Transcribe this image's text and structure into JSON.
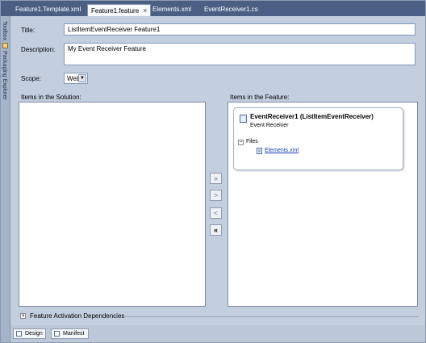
{
  "tabs": [
    {
      "label": "Feature1.Template.xml",
      "active": false
    },
    {
      "label": "Feature1.feature",
      "active": true,
      "close": "×"
    },
    {
      "label": "Elements.xml",
      "active": false
    },
    {
      "label": "EventReceiver1.cs",
      "active": false
    }
  ],
  "side_panels": [
    "Toolbox",
    "Packaging Explorer"
  ],
  "form": {
    "title_label": "Title:",
    "title_value": "ListItemEventReceiver Feature1",
    "description_label": "Description:",
    "description_value": "My Event Receiver Feature",
    "scope_label": "Scope:",
    "scope_value": "Web",
    "scope_arrow": "▼"
  },
  "solution": {
    "label": "Items in the Solution:"
  },
  "feature": {
    "label": "Items in the Feature:",
    "item_title": "EventReceiver1 (ListItemEventReceiver)",
    "item_type": "Event Receiver",
    "files_expander": "−",
    "files_label": "Files",
    "file_name": "Elements.xml"
  },
  "move_buttons": {
    "add_all": "»",
    "add": ">",
    "remove": "<",
    "remove_all": "«"
  },
  "dependencies": {
    "expander": "+",
    "label": "Feature Activation Dependencies"
  },
  "bottom_tabs": {
    "design": "Design",
    "manifest": "Manifest"
  },
  "colors": {
    "tab_strip": "#4b5f85",
    "panel_background": "#c3cedf",
    "link": "#1a3fbf"
  }
}
